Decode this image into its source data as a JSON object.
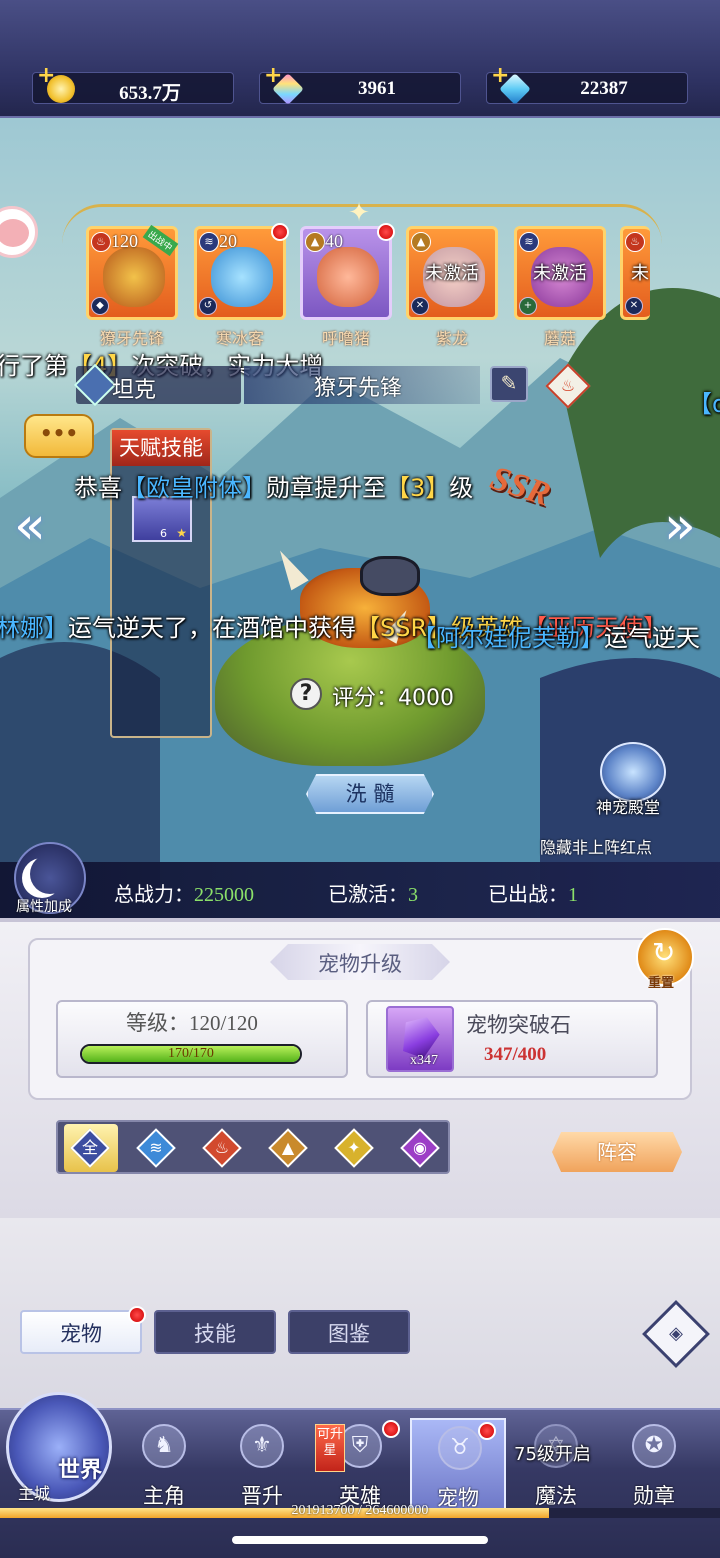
{
  "currencies": [
    {
      "icon": "gold-coin-icon",
      "value": "653.7万"
    },
    {
      "icon": "rainbow-diamond-icon",
      "value": "3961"
    },
    {
      "icon": "blue-diamond-icon",
      "value": "22387"
    }
  ],
  "pets": [
    {
      "name": "獠牙先锋",
      "level": "120",
      "tag": "出战中",
      "rarity": "ssr",
      "element": "fire",
      "active": true
    },
    {
      "name": "寒冰客",
      "level": "20",
      "rarity": "ssr",
      "element": "water",
      "active": true,
      "red_dot": true
    },
    {
      "name": "呼噜猪",
      "level": "40",
      "rarity": "sr",
      "element": "earth",
      "active": true,
      "red_dot": true
    },
    {
      "name": "紫龙",
      "rarity": "ssr",
      "element": "earth",
      "active": false,
      "status": "未激活"
    },
    {
      "name": "蘑菇",
      "rarity": "ssr",
      "element": "water",
      "active": false,
      "status": "未激活"
    },
    {
      "name": "火",
      "rarity": "ssr",
      "element": "fire",
      "active": false,
      "status": "未"
    }
  ],
  "chat": {
    "line1": {
      "pre": "行了第",
      "hl": "【4】",
      "post": "次突破，实力大增"
    },
    "line2": {
      "pre": "恭喜",
      "bl": "【欧皇附体】",
      "mid": "勋章提升至",
      "hl": "【3】",
      "post": "级"
    },
    "line3": {
      "pre_bl": "林娜】",
      "text": "运气逆天了，在酒馆中获得",
      "hl": "【SSR】级英雄",
      "red": "【亚历天使】"
    },
    "line4": {
      "bl": "【阿尔娃伲芙勒】",
      "text": "运气逆天"
    },
    "right_fragment": "【dl"
  },
  "hero": {
    "type": "坦克",
    "name": "獠牙先锋",
    "rarity": "SSR",
    "score_label": "评分：",
    "score": "4000",
    "talent_title": "天赋技能",
    "talent_count": "6",
    "wash_label": "洗 髓"
  },
  "temple": {
    "label": "神宠殿堂"
  },
  "hide_red_label": "隐藏非上阵红点",
  "stats": {
    "attr_label": "属性加成",
    "power_label": "总战力：",
    "power": "225000",
    "activated_label": "已激活：",
    "activated": "3",
    "deployed_label": "已出战：",
    "deployed": "1"
  },
  "upgrade": {
    "title": "宠物升级",
    "reset_label": "重置",
    "level_label": "等级：",
    "level": "120/120",
    "exp_text": "170/170",
    "exp_ratio": 1.0,
    "stone_name": "宠物突破石",
    "stone_count": "x347",
    "stone_progress": "347/400"
  },
  "filters": [
    {
      "name": "all",
      "glyph": "全",
      "color": "#3d4ea0"
    },
    {
      "name": "water",
      "glyph": "≋",
      "color": "#3d8ad8"
    },
    {
      "name": "fire",
      "glyph": "♨",
      "color": "#d24a2e"
    },
    {
      "name": "earth",
      "glyph": "▲",
      "color": "#c98a2c"
    },
    {
      "name": "light",
      "glyph": "✦",
      "color": "#d8b22c"
    },
    {
      "name": "dark",
      "glyph": "◉",
      "color": "#9c3ec6"
    }
  ],
  "lineup_label": "阵容",
  "subtabs": {
    "pets": "宠物",
    "skills": "技能",
    "codex": "图鉴"
  },
  "nav": {
    "world": "世界",
    "city": "主城",
    "protagonist": "主角",
    "promote": "晋升",
    "heroes": "英雄",
    "heroes_tag": "可升星",
    "pets": "宠物",
    "magic": "魔法",
    "magic_lock": "75级开启",
    "medals": "勋章"
  },
  "xp": {
    "text": "201913700 / 264600000",
    "ratio": 0.763
  }
}
